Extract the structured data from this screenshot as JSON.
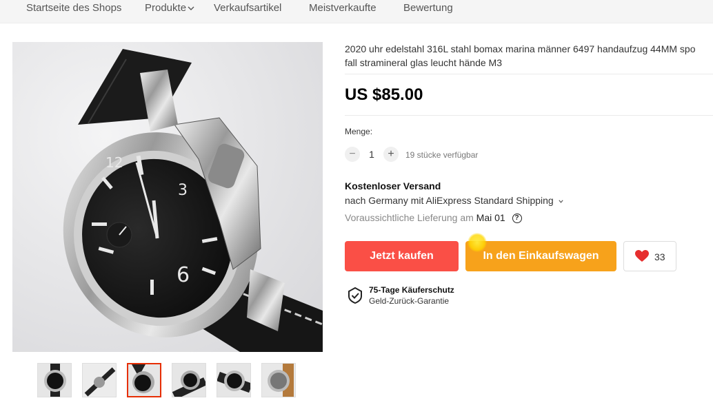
{
  "nav": {
    "items": [
      "Startseite des Shops",
      "Produkte",
      "Verkaufsartikel",
      "Meistverkaufte",
      "Bewertung"
    ]
  },
  "product": {
    "title_line1": "2020 uhr edelstahl 316L stahl bomax marina männer 6497 handaufzug 44MM spo",
    "title_line2": "fall stramineral glas leucht hände M3",
    "price": "US $85.00",
    "quantity_label": "Menge:",
    "quantity_value": "1",
    "quantity_available": "19 stücke verfügbar",
    "shipping_title": "Kostenloser Versand",
    "shipping_line": "nach Germany mit AliExpress Standard Shipping",
    "delivery_label": "Voraussichtliche Lieferung am",
    "delivery_date": "Mai 01",
    "buy_now": "Jetzt kaufen",
    "add_to_cart": "In den Einkaufswagen",
    "wishlist_count": "33",
    "protection_title": "75-Tage Käuferschutz",
    "protection_sub": "Geld-Zurück-Garantie"
  },
  "gallery": {
    "thumbnail_count": 6,
    "active_index": 2
  },
  "colors": {
    "buy_button": "#fa4f46",
    "cart_button": "#f7a21b",
    "heart": "#e62e2e",
    "active_thumb_border": "#e62e04"
  },
  "icons": [
    "chevron-down-icon",
    "minus-icon",
    "plus-icon",
    "question-icon",
    "heart-icon",
    "shield-check-icon"
  ]
}
